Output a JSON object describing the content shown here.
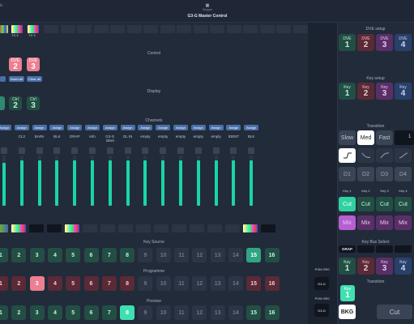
{
  "header": {
    "title": "G3-G Master Control",
    "top_label": "Shipper"
  },
  "top_strip": {
    "labels": [
      "TX 3",
      "TX 3"
    ]
  },
  "sections": {
    "control": "Control",
    "display": "Display",
    "channels": "Channels",
    "key_source": "Key Source",
    "programme": "Programme",
    "preview": "Preview"
  },
  "control": {
    "buttons": [
      {
        "label": "DVE",
        "num": "2"
      },
      {
        "label": "DVE",
        "num": "3"
      }
    ],
    "insert_label": "Insert all",
    "clear_label": "Clear all"
  },
  "display": {
    "buttons": [
      {
        "label": "Ctrl",
        "num": "2"
      },
      {
        "label": "Ctrl",
        "num": "3"
      }
    ]
  },
  "channels": {
    "assign_label": "Assign",
    "names": [
      "",
      "CL3",
      "BARs",
      "BLK",
      "GRAP",
      "Info",
      "G3-G Ident",
      "GL IN",
      "empty",
      "empty",
      "empty",
      "empty",
      "empty",
      "IDENT",
      "BLK"
    ],
    "levels": [
      0.85,
      0.9,
      0.9,
      0.9,
      0.9,
      0.9,
      0.9,
      0.9,
      0.9,
      0.9,
      0.9,
      0.9,
      0.9,
      0.9,
      0.9
    ]
  },
  "rows": {
    "key_source": [
      "1",
      "2",
      "3",
      "4",
      "5",
      "6",
      "7",
      "8",
      "9",
      "10",
      "11",
      "12",
      "13",
      "14",
      "15",
      "16"
    ],
    "programme": [
      "1",
      "2",
      "3",
      "4",
      "5",
      "6",
      "7",
      "8",
      "9",
      "10",
      "11",
      "12",
      "13",
      "14",
      "15",
      "16"
    ],
    "preview": [
      "1",
      "2",
      "3",
      "4",
      "5",
      "6",
      "7",
      "8",
      "9",
      "10",
      "11",
      "12",
      "13",
      "14",
      "15",
      "16"
    ]
  },
  "src": {
    "pgm_label": "PGM SRC",
    "pgm_value": "G3-G",
    "pvw_label": "PVW SRC",
    "pvw_value": "G3-G"
  },
  "right": {
    "dve_setup": "DVE setup",
    "dve_buttons": [
      {
        "label": "DVE",
        "num": "1"
      },
      {
        "label": "DVE",
        "num": "2"
      },
      {
        "label": "DVE",
        "num": "3"
      },
      {
        "label": "DVE",
        "num": "4"
      }
    ],
    "key_setup": "Key setup",
    "key_buttons": [
      {
        "label": "Key",
        "num": "1"
      },
      {
        "label": "Key",
        "num": "2"
      },
      {
        "label": "Key",
        "num": "3"
      },
      {
        "label": "Key",
        "num": "4"
      }
    ],
    "transition": "Transition",
    "speeds": [
      "Slow",
      "Med",
      "Fast"
    ],
    "speed_value": "1",
    "dur_buttons": [
      "D1",
      "D2",
      "D3",
      "D4"
    ],
    "key_labels": [
      "Key 1",
      "Key 2",
      "Key 3",
      "Key 4"
    ],
    "cut_label": "Cut",
    "mix_label": "Mix",
    "key_bus_select": "Key Bus Select",
    "grap_label": "GRAP",
    "key_bus_buttons": [
      {
        "label": "Key",
        "num": "1"
      },
      {
        "label": "Key",
        "num": "2"
      },
      {
        "label": "Key",
        "num": "3"
      },
      {
        "label": "Key",
        "num": "4"
      }
    ],
    "transition2": "Transition",
    "key1": {
      "label": "Key",
      "num": "1"
    },
    "bkg_label": "BKG",
    "cut_big": "Cut"
  }
}
